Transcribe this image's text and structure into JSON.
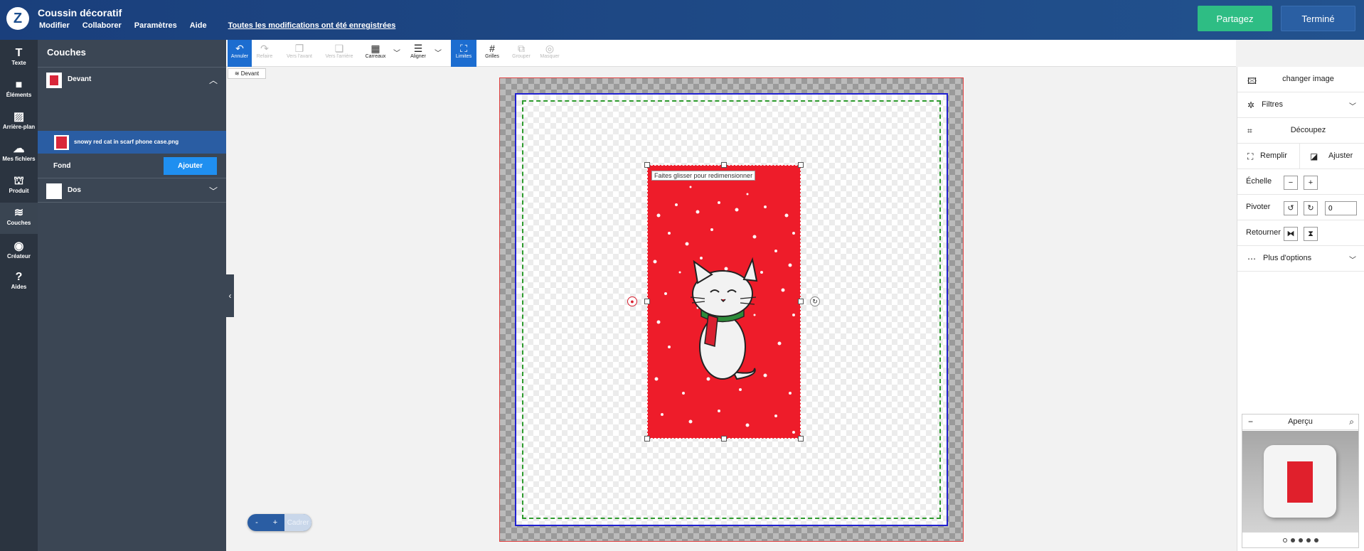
{
  "header": {
    "title": "Coussin décoratif",
    "menu": [
      "Modifier",
      "Collaborer",
      "Paramètres",
      "Aide"
    ],
    "saved_status": "Toutes les modifications ont été enregistrées",
    "share_label": "Partagez",
    "done_label": "Terminé"
  },
  "iconbar": [
    {
      "label": "Texte",
      "icon": "text-icon"
    },
    {
      "label": "Éléments",
      "icon": "elements-icon"
    },
    {
      "label": "Arrière-plan",
      "icon": "background-icon"
    },
    {
      "label": "Mes fichiers",
      "icon": "cloud-upload-icon"
    },
    {
      "label": "Produit",
      "icon": "product-icon"
    },
    {
      "label": "Couches",
      "icon": "layers-icon"
    },
    {
      "label": "Créateur",
      "icon": "user-icon"
    },
    {
      "label": "Aides",
      "icon": "help-icon"
    }
  ],
  "layers": {
    "title": "Couches",
    "front": "Devant",
    "selected_item": "snowy red cat in scarf phone case.png",
    "background": "Fond",
    "add_label": "Ajouter",
    "back": "Dos"
  },
  "toolbar": [
    {
      "label": "Annuler",
      "icon": "undo-icon",
      "state": "active"
    },
    {
      "label": "Refaire",
      "icon": "redo-icon",
      "state": "disabled"
    },
    {
      "label": "Vers l'avant",
      "icon": "bring-forward-icon",
      "state": "disabled"
    },
    {
      "label": "Vers l'arrière",
      "icon": "send-backward-icon",
      "state": "disabled"
    },
    {
      "label": "Carreaux",
      "icon": "tiles-icon",
      "state": "normal"
    },
    {
      "label": "Aligner",
      "icon": "align-icon",
      "state": "normal"
    },
    {
      "label": "Limites",
      "icon": "bounds-icon",
      "state": "active"
    },
    {
      "label": "Grilles",
      "icon": "grid-icon",
      "state": "normal"
    },
    {
      "label": "Grouper",
      "icon": "group-icon",
      "state": "disabled"
    },
    {
      "label": "Masquer",
      "icon": "hide-icon",
      "state": "disabled"
    }
  ],
  "canvas": {
    "face_tag": "Devant",
    "resize_hint": "Faites glisser pour redimensionner"
  },
  "zoom": {
    "minus": "-",
    "plus": "+",
    "fit": "Cadrer"
  },
  "right_panel": {
    "change_image": "changer image",
    "filters": "Filtres",
    "crop": "Découpez",
    "fill": "Remplir",
    "fit": "Ajuster",
    "scale": "Échelle",
    "rotate": "Pivoter",
    "rotate_value": "0",
    "flip": "Retourner",
    "more": "Plus d'options"
  },
  "preview": {
    "title": "Aperçu",
    "minimize": "−"
  },
  "colors": {
    "header": "#1c4f8f",
    "share": "#2ebd84",
    "accent": "#1c6dd0",
    "artwork": "#ee1c2a"
  }
}
